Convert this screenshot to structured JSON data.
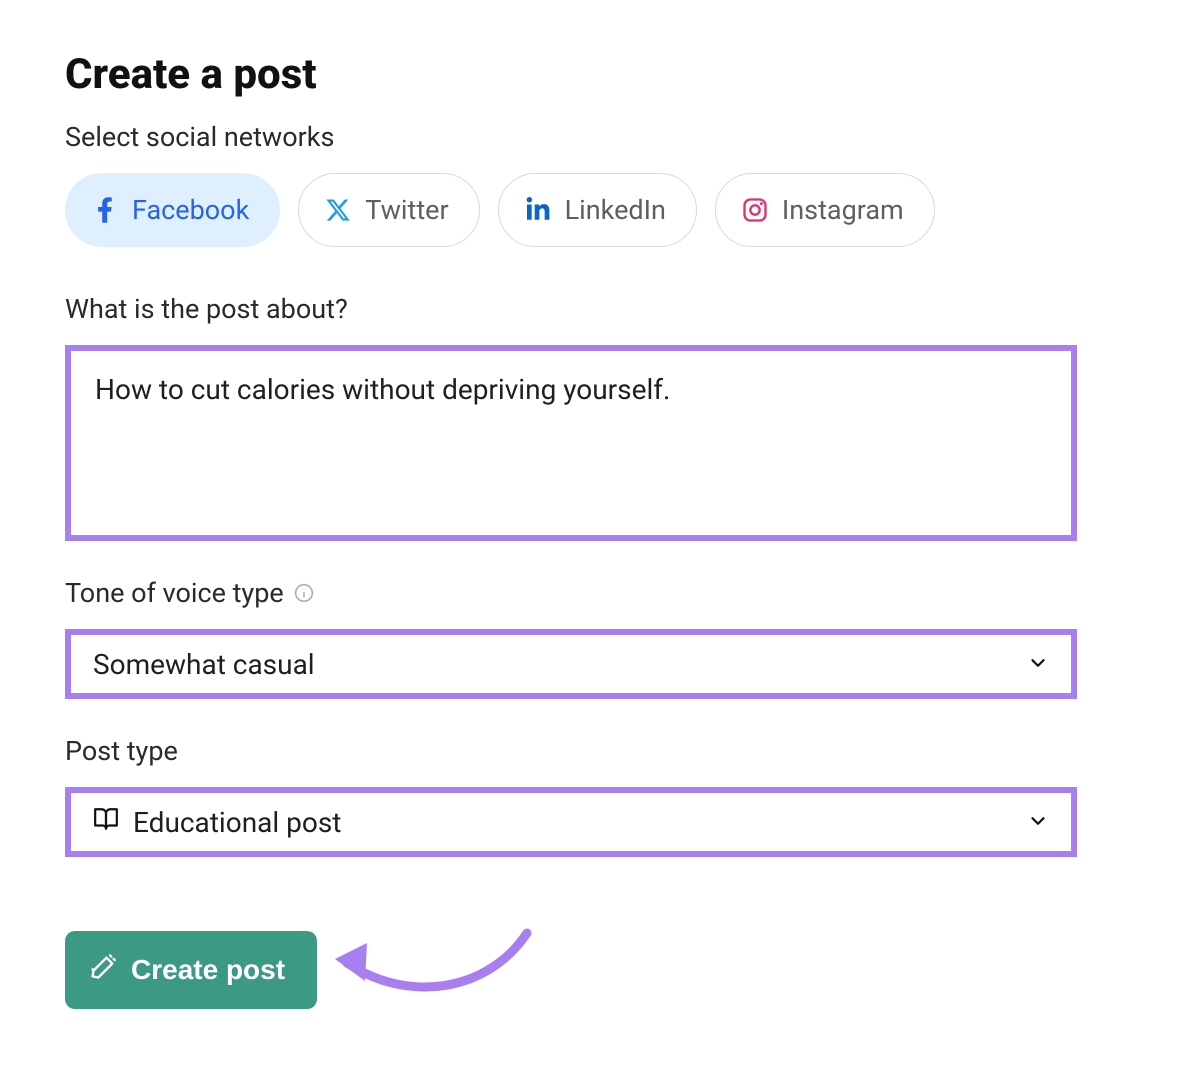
{
  "title": "Create a post",
  "networks": {
    "label": "Select social networks",
    "items": [
      {
        "name": "Facebook",
        "selected": true
      },
      {
        "name": "Twitter",
        "selected": false
      },
      {
        "name": "LinkedIn",
        "selected": false
      },
      {
        "name": "Instagram",
        "selected": false
      }
    ]
  },
  "about": {
    "label": "What is the post about?",
    "value": "How to cut calories without depriving yourself."
  },
  "tone": {
    "label": "Tone of voice type",
    "value": "Somewhat casual"
  },
  "post_type": {
    "label": "Post type",
    "value": "Educational post"
  },
  "create_button": "Create post",
  "colors": {
    "highlight": "#a87ef0",
    "primary_button": "#3c9a84",
    "selected_chip_bg": "#dfeffe",
    "selected_chip_text": "#2563eb"
  }
}
